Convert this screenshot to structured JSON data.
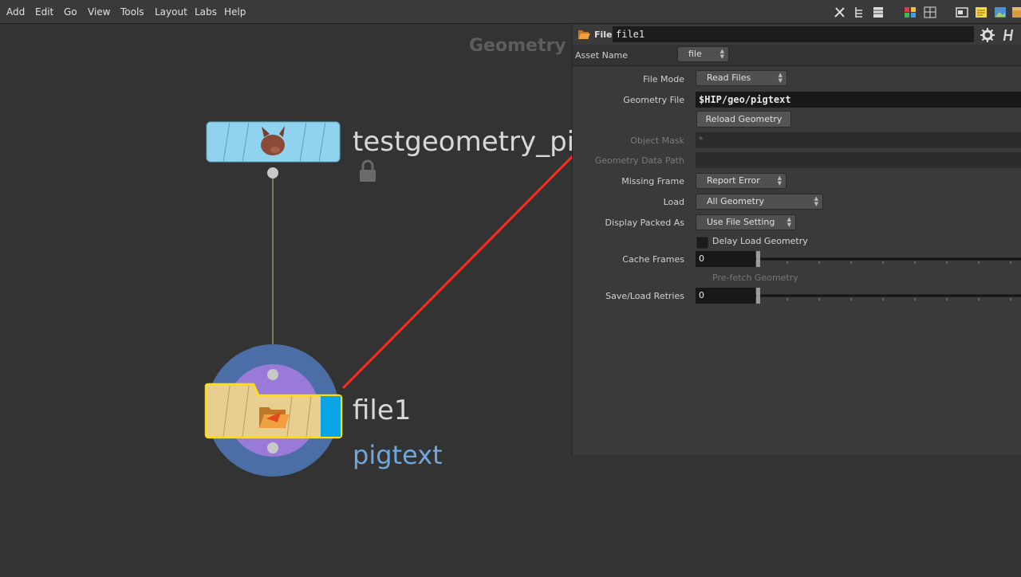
{
  "menu": {
    "items": [
      "Add",
      "Edit",
      "Go",
      "View",
      "Tools",
      "Layout",
      "Labs",
      "Help"
    ]
  },
  "toolbar_icons": [
    "tools-icon",
    "tree-icon",
    "list-icon",
    "grid-color-icon",
    "grid-icon",
    "window-icon",
    "note-icon",
    "image-icon",
    "package-icon"
  ],
  "network": {
    "context_label": "Geometry",
    "nodes": [
      {
        "name": "testgeometry_pig",
        "icon": "pig-head-icon",
        "color": "#8fd3ef"
      },
      {
        "name": "file1",
        "subtitle": "pigtext",
        "icon": "open-folder-icon",
        "color": "#e8cf8f"
      }
    ]
  },
  "params": {
    "type_label": "File",
    "node_name": "file1",
    "asset_name_label": "Asset Name",
    "asset_name_value": "file",
    "file_mode_label": "File Mode",
    "file_mode_value": "Read Files",
    "geometry_file_label": "Geometry File",
    "geometry_file_value": "$HIP/geo/pigtext",
    "reload_label": "Reload Geometry",
    "object_mask_label": "Object Mask",
    "object_mask_value": "*",
    "geo_data_path_label": "Geometry Data Path",
    "missing_frame_label": "Missing Frame",
    "missing_frame_value": "Report Error",
    "load_label": "Load",
    "load_value": "All Geometry",
    "display_packed_label": "Display Packed As",
    "display_packed_value": "Use File Setting",
    "delay_load_label": "Delay Load Geometry",
    "cache_frames_label": "Cache Frames",
    "cache_frames_value": "0",
    "prefetch_label": "Pre-fetch Geometry",
    "retries_label": "Save/Load Retries",
    "retries_value": "0"
  },
  "colors": {
    "annotation_arrow": "#ff2a1a",
    "selection": "#ffe000"
  }
}
